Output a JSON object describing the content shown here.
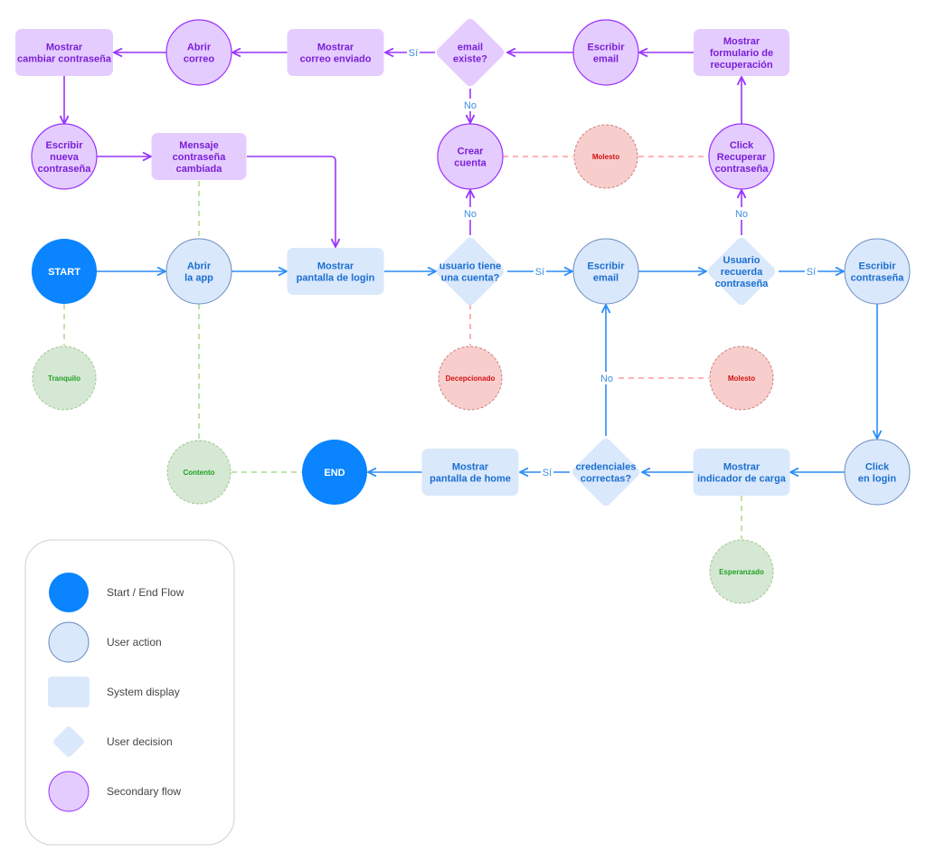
{
  "colors": {
    "start_end": "#0a84ff",
    "user_action_fill": "#dae8fc",
    "user_action_stroke": "#6c8ebf",
    "system_fill": "#dae8fc",
    "primary_edge": "#2b8cf7",
    "primary_text": "#1a6fcf",
    "secondary_fill": "#e5ccff",
    "secondary_stroke": "#9933ff",
    "secondary_text": "#7a1fd6",
    "negative_fill": "#f8cecc",
    "negative_stroke": "#b85450",
    "negative_text": "#d01010",
    "positive_fill": "#d5e8d4",
    "positive_stroke": "#82b366",
    "positive_text": "#22a022",
    "negative_link": "#ff9999",
    "positive_link": "#a8dc8c",
    "edge_label": "#3d8fe0"
  },
  "nodes": {
    "start": {
      "lines": [
        "START"
      ]
    },
    "end": {
      "lines": [
        "END"
      ]
    },
    "abrir_app": {
      "lines": [
        "Abrir",
        "la app"
      ]
    },
    "pantalla_login": {
      "lines": [
        "Mostrar",
        "pantalla de login"
      ]
    },
    "tiene_cuenta": {
      "lines": [
        "usuario tiene",
        "una cuenta?"
      ]
    },
    "escribir_email": {
      "lines": [
        "Escribir",
        "email"
      ]
    },
    "recuerda_pass": {
      "lines": [
        "Usuario",
        "recuerda",
        "contraseña"
      ]
    },
    "escribir_pass": {
      "lines": [
        "Escribir",
        "contraseña"
      ]
    },
    "click_login": {
      "lines": [
        "Click",
        "en login"
      ]
    },
    "indicador_carga": {
      "lines": [
        "Mostrar",
        "indicador de carga"
      ]
    },
    "credenciales": {
      "lines": [
        "credenciales",
        "correctas?"
      ]
    },
    "pantalla_home": {
      "lines": [
        "Mostrar",
        "pantalla de home"
      ]
    },
    "cambiar_pass": {
      "lines": [
        "Mostrar",
        "cambiar contraseña"
      ]
    },
    "abrir_correo": {
      "lines": [
        "Abrir",
        "correo"
      ]
    },
    "correo_enviado": {
      "lines": [
        "Mostrar",
        "correo enviado"
      ]
    },
    "email_existe": {
      "lines": [
        "email",
        "existe?"
      ]
    },
    "escribir_email_2": {
      "lines": [
        "Escribir",
        "email"
      ]
    },
    "form_recuperacion": {
      "lines": [
        "Mostrar",
        "formulario de",
        "recuperación"
      ]
    },
    "nueva_pass": {
      "lines": [
        "Escribir",
        "nueva",
        "contraseña"
      ]
    },
    "mensaje_cambiada": {
      "lines": [
        "Mensaje",
        "contraseña",
        "cambiada"
      ]
    },
    "crear_cuenta": {
      "lines": [
        "Crear",
        "cuenta"
      ]
    },
    "click_recuperar": {
      "lines": [
        "Click",
        "Recuperar",
        "contraseña"
      ]
    }
  },
  "emotions": {
    "tranquilo": "Tranquilo",
    "contento": "Contento",
    "decepcionado": "Decepcionado",
    "molesto_1": "Molesto",
    "molesto_2": "Molesto",
    "esperanzado": "Esperanzado"
  },
  "edge_labels": {
    "si": "Sí",
    "no": "No"
  },
  "legend": {
    "items": [
      {
        "label": "Start / End Flow"
      },
      {
        "label": "User action"
      },
      {
        "label": "System display"
      },
      {
        "label": "User decision"
      },
      {
        "label": "Secondary flow"
      }
    ]
  }
}
